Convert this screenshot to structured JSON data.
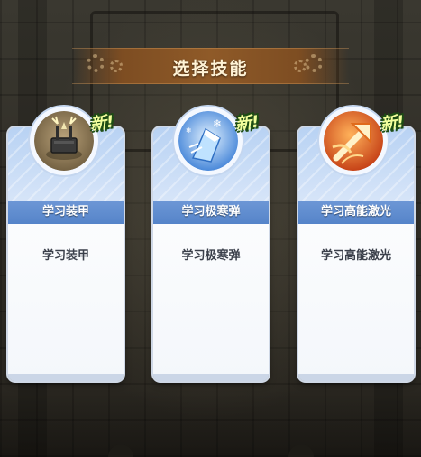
{
  "title": "选择技能",
  "new_badge": "新!",
  "colors": {
    "banner": "#8f5a28",
    "card_label_bg": "#5584c9",
    "new_badge_text": "#f3ff9c"
  },
  "skills": [
    {
      "name": "学习装甲",
      "description": "学习装甲",
      "icon": "armor-turret-icon"
    },
    {
      "name": "学习极寒弹",
      "description": "学习极寒弹",
      "icon": "frost-bullet-icon"
    },
    {
      "name": "学习高能激光",
      "description": "学习高能激光",
      "icon": "laser-arrow-icon"
    }
  ]
}
